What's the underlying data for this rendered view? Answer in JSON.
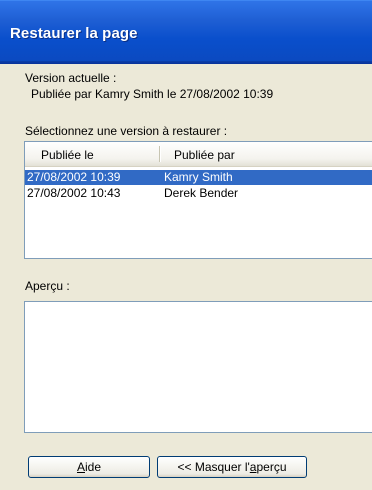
{
  "dialog": {
    "title": "Restaurer la page"
  },
  "current_version": {
    "label": "Version actuelle :",
    "detail": "Publiée par Kamry Smith le 27/08/2002 10:39"
  },
  "versions": {
    "label": "Sélectionnez une version à restaurer :",
    "columns": [
      "Publiée le",
      "Publiée par"
    ],
    "rows": [
      {
        "date": "27/08/2002 10:39",
        "author": "Kamry Smith",
        "selected": true
      },
      {
        "date": "27/08/2002 10:43",
        "author": "Derek Bender",
        "selected": false
      }
    ]
  },
  "preview": {
    "label": "Aperçu :"
  },
  "buttons": {
    "help_prefix": "",
    "help_mnemonic": "A",
    "help_suffix": "ide",
    "hide_preview_prefix": "<< Masquer l'",
    "hide_preview_mnemonic": "a",
    "hide_preview_suffix": "perçu"
  }
}
